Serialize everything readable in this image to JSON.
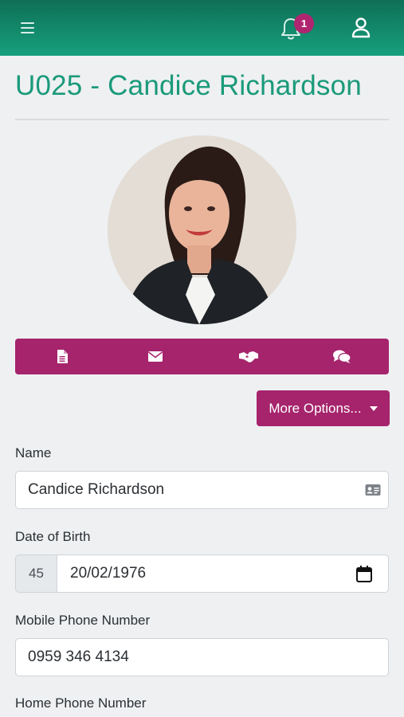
{
  "header": {
    "notification_count": "1",
    "colors": {
      "bar_top": "#0f6f57",
      "bar_bottom": "#16a07d",
      "badge": "#b0256f"
    }
  },
  "profile": {
    "title": "U025 - Candice Richardson",
    "photo_alt": "profile-photo"
  },
  "actions": {
    "icons": [
      "document-icon",
      "envelope-icon",
      "handshake-icon",
      "chat-icon"
    ],
    "accent": "#a5246c"
  },
  "more_options": {
    "label": "More Options..."
  },
  "form": {
    "name_label": "Name",
    "name_value": "Candice Richardson",
    "dob_label": "Date of Birth",
    "dob_age": "45",
    "dob_value": "20/02/1976",
    "mobile_label": "Mobile Phone Number",
    "mobile_value": "0959 346 4134",
    "home_label": "Home Phone Number"
  }
}
